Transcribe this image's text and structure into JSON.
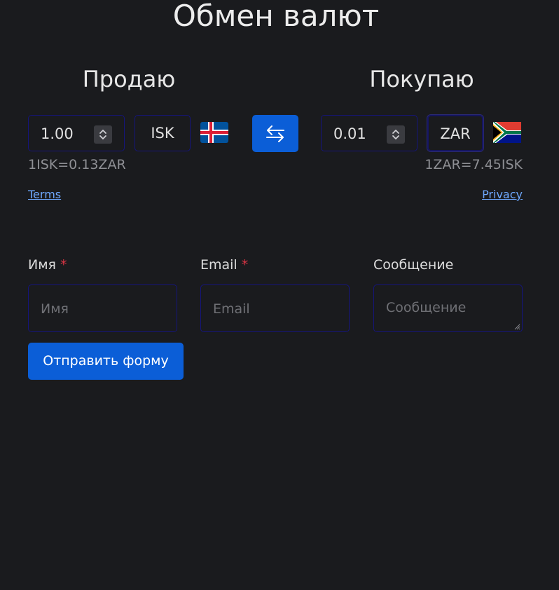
{
  "title": "Обмен валют",
  "sell": {
    "heading": "Продаю",
    "amount": "1.00",
    "currency": "ISK",
    "flag": "iceland-flag",
    "rate": "1ISK=0.13ZAR"
  },
  "buy": {
    "heading": "Покупаю",
    "amount": "0.01",
    "currency": "ZAR",
    "flag": "south-africa-flag",
    "rate": "1ZAR=7.45ISK"
  },
  "swap_icon": "swap-arrows-icon",
  "links": {
    "terms": "Terms",
    "privacy": "Privacy"
  },
  "form": {
    "name_label": "Имя",
    "name_placeholder": "Имя",
    "email_label": "Email",
    "email_placeholder": "Email",
    "message_label": "Сообщение",
    "message_placeholder": "Сообщение",
    "required_mark": "*",
    "submit_label": "Отправить форму"
  },
  "colors": {
    "background": "#1a1b1e",
    "accent": "#0b5ed7",
    "input_border": "#15157a",
    "link": "#6ea8fe",
    "required": "#dc3545"
  }
}
